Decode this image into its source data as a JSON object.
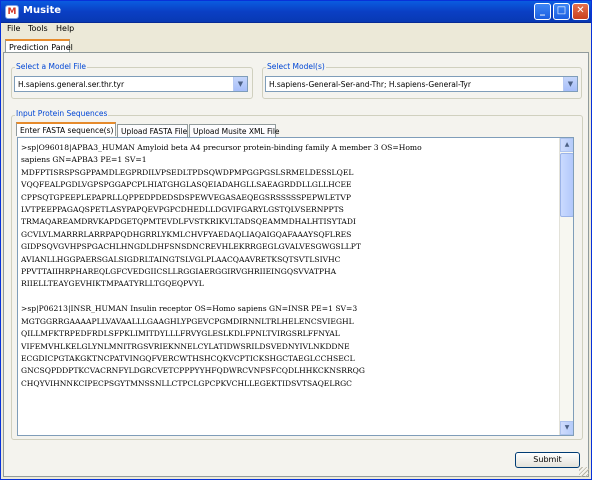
{
  "window": {
    "title": "Musite",
    "app_icon_glyph": "M",
    "minimize_glyph": "_",
    "maximize_glyph": "□",
    "close_glyph": "✕"
  },
  "menu": {
    "items": [
      "File",
      "Tools",
      "Help"
    ]
  },
  "tabs": {
    "main": "Prediction Panel"
  },
  "model_file": {
    "label": "Select a Model File",
    "value": "H.sapiens.general.ser.thr.tyr"
  },
  "models": {
    "label": "Select Model(s)",
    "value": "H.sapiens-General-Ser-and-Thr; H.sapiens-General-Tyr"
  },
  "input": {
    "label": "Input Protein Sequences",
    "tabs": [
      "Enter FASTA sequence(s)",
      "Upload FASTA File",
      "Upload Musite XML File"
    ],
    "active_tab": "Enter FASTA sequence(s)",
    "lines": [
      ">sp|O96018|APBA3_HUMAN Amyloid beta A4 precursor protein-binding family A member 3 OS=Homo",
      "sapiens GN=APBA3 PE=1 SV=1",
      "MDFPTISRSPSGPPAMDLEGPRDILVPSEDLTPDSQWDPMPGGPGSLSRMELDESSLQEL",
      "VQQFEALPGDLVGPSPGGAPCPLHIATGHGLASQEIADAHGLLSAEAGRDDLLGLLHCEE",
      "CPPSQTGPEEPLEPAPRLLQPPEDPDEDSDSPEWVEGASAEQEGSRSSSSSPEPWLETVP",
      "LVTPEEPPAGAQSPETLASYPAPQEVPGPCDHEDLLDGVIFGARYLGSTQLVSERNPPTS",
      "TRMAQAREAMDRVKAPDGETQPMTEVDLFVSTKRIKVLTADSQEAMMDHALHTISYTADI",
      "GCVLVLMARRRLARRPAPQDHGRRLYKMLCHVFYAEDAQLIAQAIGQAFAAAYSQFLRES",
      "GIDPSQVGVHPSPGACHLHNGDLDHFSNSDNCREVHLEKRRGEGLGVALVESGWGSLLPT",
      "AVIANLLHGGPAERSGALSIGDRLTAINGTSLVGLPLAACQAAVRETKSQTSVTLSIVHC",
      "PPVTTAIIHRPHAREQLGFCVEDGIICSLLRGGIAERGGIRVGHRIIEINGQSVVATPHA",
      "RIIELLTEAYGEVHIKTMPAATYRLLTGQEQPVYL",
      "",
      ">sp|P06213|INSR_HUMAN Insulin receptor OS=Homo sapiens GN=INSR PE=1 SV=3",
      "MGTGGRRGAAAAPLLVAVAALLLGAAGHLYPGEVCPGMDIRNNLTRLHELENCSVIEGHL",
      "QILLMFKTRPEDFRDLSFPKLIMITDYLLLFRVYGLESLKDLFPNLTVIRGSRLFFNYAL",
      "VIFEMVHLKELGLYNLMNITRGSVRIEKNNELCYLATIDWSRILDSVEDNYIVLNKDDNE",
      "ECGDICPGTAKGKTNCPATVINGQFVERCWTHSHCQKVCPTICKSHGCTAEGLCCHSECL",
      "GNCSQPDDPTKCVACRNFYLDGRCVETCPPPYYHFQDWRCVNFSFCQDLHHKCKNSRRQG",
      "CHQYVIHNNKCIPECPSGYTMNSSNLLCTPCLGPCPKVCHLLEGEKTIDSVTSAQELRGC"
    ]
  },
  "actions": {
    "submit": "Submit"
  }
}
